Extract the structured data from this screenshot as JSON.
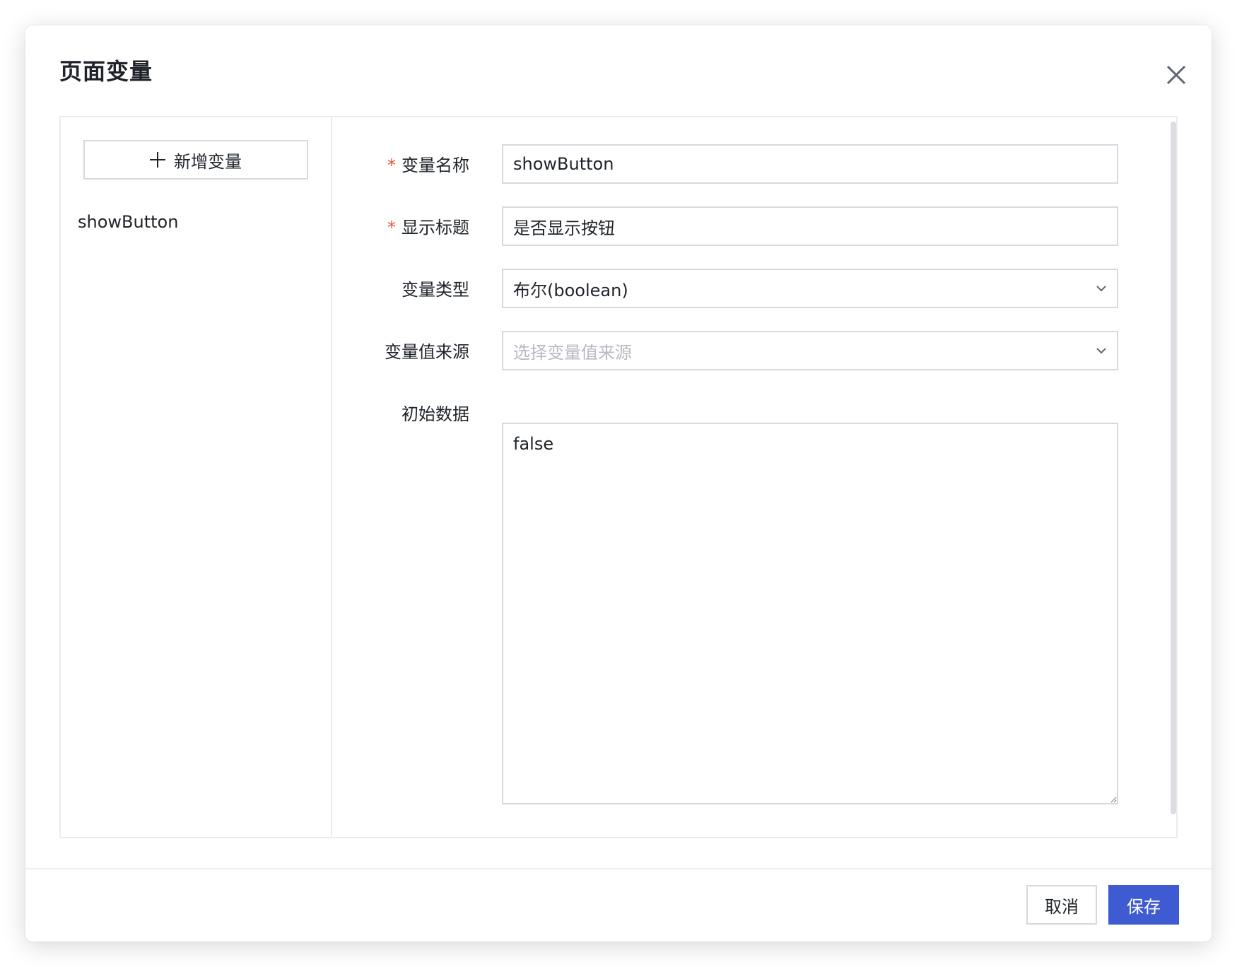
{
  "dialog": {
    "title": "页面变量"
  },
  "sidebar": {
    "add_label": "新增变量",
    "items": [
      {
        "label": "showButton"
      }
    ]
  },
  "form": {
    "var_name": {
      "label": "变量名称",
      "required": "*",
      "value": "showButton"
    },
    "display_title": {
      "label": "显示标题",
      "required": "*",
      "value": "是否显示按钮"
    },
    "var_type": {
      "label": "变量类型",
      "value": "布尔(boolean)"
    },
    "value_source": {
      "label": "变量值来源",
      "placeholder": "选择变量值来源"
    },
    "initial_data": {
      "label": "初始数据",
      "value": "false"
    }
  },
  "footer": {
    "cancel_label": "取消",
    "save_label": "保存"
  },
  "colors": {
    "primary": "#3e5bd2",
    "required": "#e8533a",
    "border": "#d7d9de",
    "placeholder": "#b6b9c0"
  },
  "icons": [
    "close-icon",
    "plus-icon",
    "chevron-down-icon",
    "resize-handle-icon"
  ]
}
